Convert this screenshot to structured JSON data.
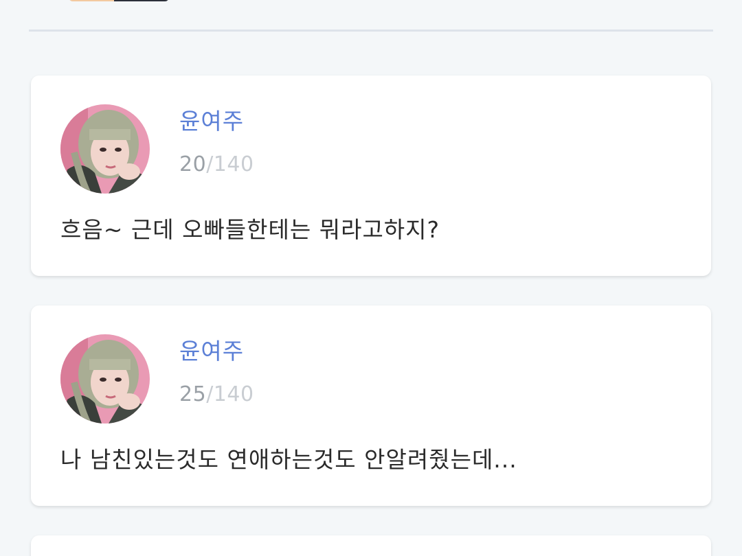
{
  "posts": [
    {
      "author": "윤여주",
      "count": "20",
      "separator": "/",
      "max": "140",
      "message": "흐음~ 근데 오빠들한테는 뭐라고하지?"
    },
    {
      "author": "윤여주",
      "count": "25",
      "separator": "/",
      "max": "140",
      "message": "나 남친있는것도 연애하는것도 안알려줬는데..."
    }
  ],
  "colors": {
    "background": "#f4f7f9",
    "author": "#5b7fd6",
    "counter": "#9aa0a6",
    "message": "#2a2a2a"
  }
}
